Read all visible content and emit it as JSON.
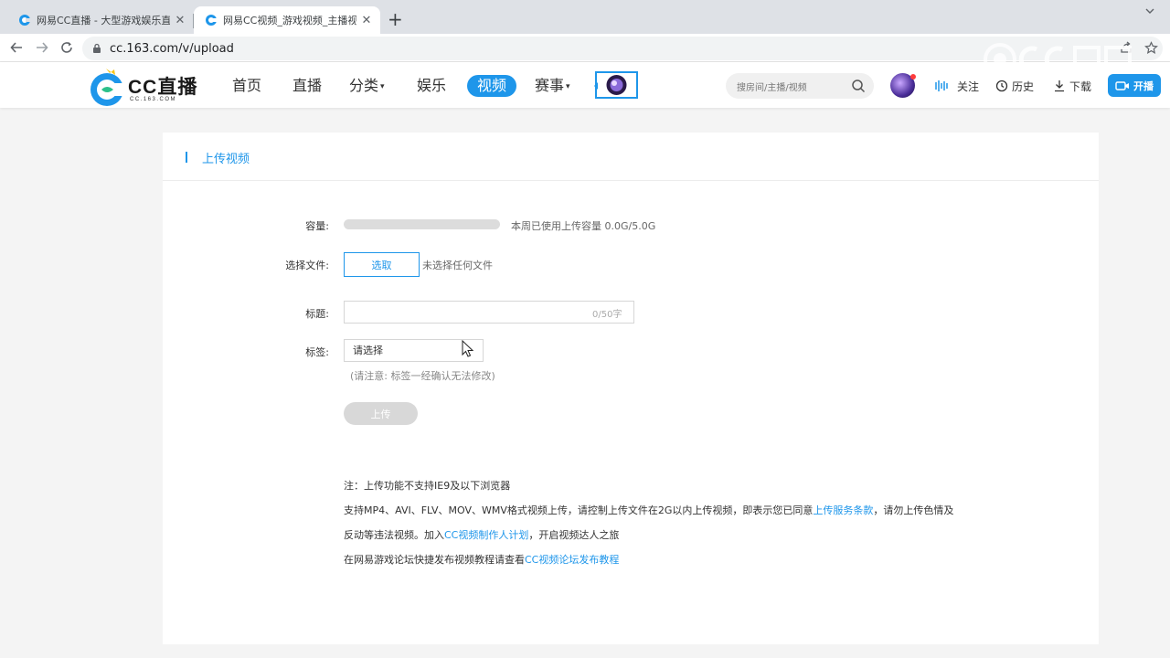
{
  "browser": {
    "tabs": [
      {
        "title": "网易CC直播 - 大型游戏娱乐直播",
        "active": false
      },
      {
        "title": "网易CC视频_游戏视频_主播视频",
        "active": true
      }
    ],
    "new_tab": "+",
    "close_symbol": "✕",
    "url": "cc.163.com/v/upload"
  },
  "header": {
    "logo_text": "CC直播",
    "logo_sub": "CC.163.COM",
    "nav": [
      {
        "label": "首页"
      },
      {
        "label": "直播"
      },
      {
        "label": "分类",
        "caret": "▾"
      },
      {
        "label": "娱乐"
      },
      {
        "label": "视频",
        "active": true
      },
      {
        "label": "赛事",
        "caret": "▾"
      }
    ],
    "search_placeholder": "搜房间/主播/视频",
    "links": {
      "follow": "关注",
      "history": "历史",
      "download": "下载"
    },
    "live_button": "开播"
  },
  "upload": {
    "card_title": "上传视频",
    "capacity_label": "容量:",
    "capacity_text": "本周已使用上传容量 0.0G/5.0G",
    "capacity_fraction": 0,
    "file_label": "选择文件:",
    "pick_button": "选取",
    "no_file": "未选择任何文件",
    "title_label": "标题:",
    "title_value": "",
    "title_counter": "0/50字",
    "tag_label": "标签:",
    "tag_placeholder": "请选择",
    "tag_note": "(请注意: 标签一经确认无法修改)",
    "upload_button": "上传"
  },
  "notes": {
    "line1": "注：上传功能不支持IE9及以下浏览器",
    "line2_a": "支持MP4、AVI、FLV、MOV、WMV格式视频上传，请控制上传文件在2G以内上传视频，即表示您已同意",
    "line2_link": "上传服务条款",
    "line2_b": "，请勿上传色情及",
    "line3_a": "反动等违法视频。加入",
    "line3_link": "CC视频制作人计划",
    "line3_b": "，开启视频达人之旅",
    "line4_a": "在网易游戏论坛快捷发布视频教程请查看",
    "line4_link": "CC视频论坛发布教程"
  },
  "colors": {
    "accent": "#1e96ea",
    "disabled": "#d8d8d8"
  }
}
